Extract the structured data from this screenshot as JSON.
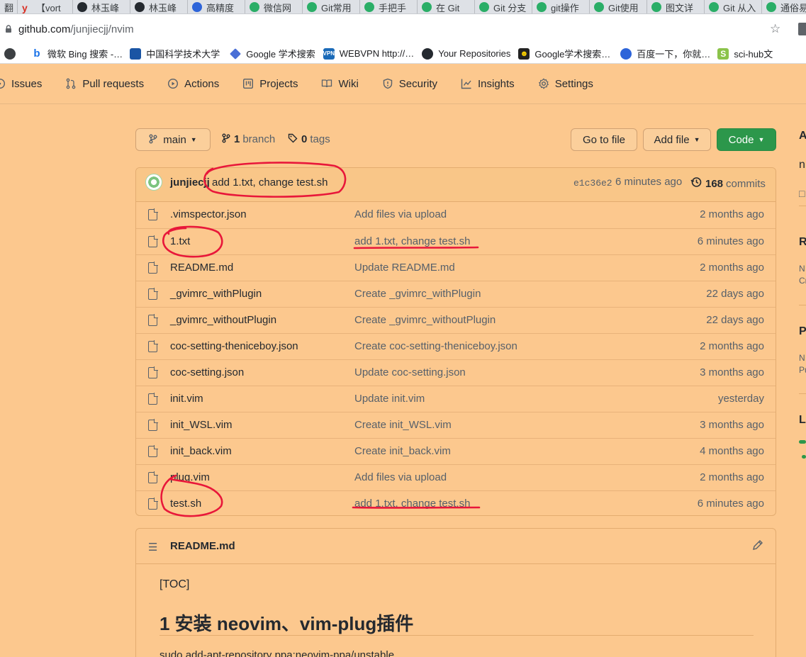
{
  "browser": {
    "tabs": [
      {
        "label": "翻",
        "icon": "none"
      },
      {
        "label": "【vort",
        "icon": "y-icon"
      },
      {
        "label": "林玉峰",
        "icon": "github-icon"
      },
      {
        "label": "林玉峰",
        "icon": "github-icon"
      },
      {
        "label": "高精度",
        "icon": "baidu-icon"
      },
      {
        "label": "微信网",
        "icon": "wechat-icon"
      },
      {
        "label": "Git常用",
        "icon": "wechat-icon"
      },
      {
        "label": "手把手",
        "icon": "wechat-icon"
      },
      {
        "label": "在 Git",
        "icon": "wechat-icon"
      },
      {
        "label": "Git 分支",
        "icon": "wechat-icon"
      },
      {
        "label": "git操作",
        "icon": "wechat-icon"
      },
      {
        "label": "Git使用",
        "icon": "wechat-icon"
      },
      {
        "label": "图文详",
        "icon": "wechat-icon"
      },
      {
        "label": "Git 从入",
        "icon": "wechat-icon"
      },
      {
        "label": "通俗易",
        "icon": "wechat-icon"
      }
    ],
    "url_host": "github.com",
    "url_path": "/junjiecjj/nvim",
    "bookmarks": [
      {
        "label": "",
        "icon": "apps-icon"
      },
      {
        "label": "微软 Bing 搜索 -…",
        "icon": "bing-icon"
      },
      {
        "label": "中国科学技术大学",
        "icon": "ustc-icon"
      },
      {
        "label": "Google 学术搜索",
        "icon": "scholar-icon"
      },
      {
        "label": "WEBVPN http://…",
        "icon": "webvpn-icon"
      },
      {
        "label": "Your Repositories",
        "icon": "github-icon"
      },
      {
        "label": "Google学术搜索…",
        "icon": "scholar-mirror-icon"
      },
      {
        "label": "百度一下，你就…",
        "icon": "baidu-icon"
      },
      {
        "label": "sci-hub文",
        "icon": "scihub-icon"
      }
    ]
  },
  "repo_nav": [
    {
      "label": "Issues",
      "icon": "issue-icon"
    },
    {
      "label": "Pull requests",
      "icon": "pull-request-icon"
    },
    {
      "label": "Actions",
      "icon": "play-icon"
    },
    {
      "label": "Projects",
      "icon": "project-icon"
    },
    {
      "label": "Wiki",
      "icon": "book-icon"
    },
    {
      "label": "Security",
      "icon": "shield-icon"
    },
    {
      "label": "Insights",
      "icon": "graph-icon"
    },
    {
      "label": "Settings",
      "icon": "gear-icon"
    }
  ],
  "toolbar": {
    "branch_label": "main",
    "branch_count": "1",
    "branch_word": "branch",
    "tag_count": "0",
    "tag_word": "tags",
    "goto_file": "Go to file",
    "add_file": "Add file",
    "code": "Code"
  },
  "latest_commit": {
    "author": "junjiecjj",
    "message": "add 1.txt, change test.sh",
    "sha": "e1c36e2",
    "time": "6 minutes ago",
    "count": "168",
    "count_word": "commits"
  },
  "files": [
    {
      "name": ".vimspector.json",
      "message": "Add files via upload",
      "age": "2 months ago"
    },
    {
      "name": "1.txt",
      "message": "add 1.txt, change test.sh",
      "age": "6 minutes ago"
    },
    {
      "name": "README.md",
      "message": "Update README.md",
      "age": "2 months ago"
    },
    {
      "name": "_gvimrc_withPlugin",
      "message": "Create _gvimrc_withPlugin",
      "age": "22 days ago"
    },
    {
      "name": "_gvimrc_withoutPlugin",
      "message": "Create _gvimrc_withoutPlugin",
      "age": "22 days ago"
    },
    {
      "name": "coc-setting-theniceboy.json",
      "message": "Create coc-setting-theniceboy.json",
      "age": "2 months ago"
    },
    {
      "name": "coc-setting.json",
      "message": "Update coc-setting.json",
      "age": "3 months ago"
    },
    {
      "name": "init.vim",
      "message": "Update init.vim",
      "age": "yesterday"
    },
    {
      "name": "init_WSL.vim",
      "message": "Create init_WSL.vim",
      "age": "3 months ago"
    },
    {
      "name": "init_back.vim",
      "message": "Create init_back.vim",
      "age": "4 months ago"
    },
    {
      "name": "plug.vim",
      "message": "Add files via upload",
      "age": "2 months ago"
    },
    {
      "name": "test.sh",
      "message": "add 1.txt, change test.sh",
      "age": "6 minutes ago"
    }
  ],
  "readme": {
    "title": "README.md",
    "toc": "[TOC]",
    "heading": "1 安装 neovim、vim-plug插件",
    "code_line": "sudo add-apt-repository ppa:neovim-ppa/unstable"
  },
  "sidebar": {
    "about_initial": "A",
    "desc_initial": "n",
    "releases_initial": "R",
    "releases_line1": "N",
    "releases_line2": "Cr",
    "packages_initial": "P",
    "packages_line1": "N",
    "packages_line2": "Pu",
    "languages_initial": "L"
  },
  "colors": {
    "page_bg": "#fcc88e",
    "code_button": "#2c974b",
    "annotation_red": "#e8173a"
  }
}
